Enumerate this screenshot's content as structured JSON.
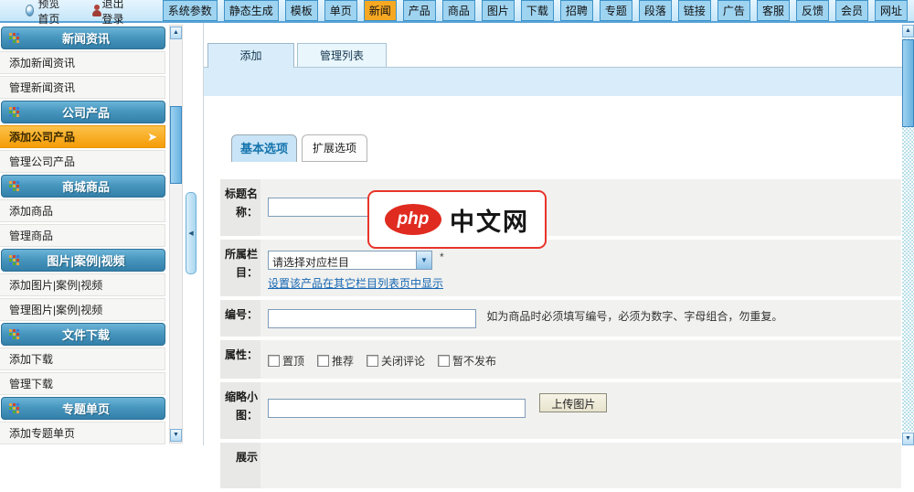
{
  "topbar": {
    "preview_label": "预览首页",
    "logout_label": "退出登录",
    "menu": [
      "系统参数",
      "静态生成",
      "模板",
      "单页",
      "新闻",
      "产品",
      "商品",
      "图片",
      "下载",
      "招聘",
      "专题",
      "段落",
      "链接",
      "广告",
      "客服",
      "反馈",
      "会员",
      "网址"
    ],
    "active_menu": "新闻"
  },
  "sidebar": {
    "sections": [
      {
        "title": "新闻资讯",
        "items": [
          {
            "label": "添加新闻资讯"
          },
          {
            "label": "管理新闻资讯"
          }
        ]
      },
      {
        "title": "公司产品",
        "items": [
          {
            "label": "添加公司产品",
            "active": true
          },
          {
            "label": "管理公司产品"
          }
        ]
      },
      {
        "title": "商城商品",
        "items": [
          {
            "label": "添加商品"
          },
          {
            "label": "管理商品"
          }
        ]
      },
      {
        "title": "图片|案例|视频",
        "items": [
          {
            "label": "添加图片|案例|视频"
          },
          {
            "label": "管理图片|案例|视频"
          }
        ]
      },
      {
        "title": "文件下载",
        "items": [
          {
            "label": "添加下载"
          },
          {
            "label": "管理下载"
          }
        ]
      },
      {
        "title": "专题单页",
        "items": [
          {
            "label": "添加专题单页"
          }
        ]
      }
    ]
  },
  "main": {
    "tabs": [
      {
        "label": "添加",
        "active": true
      },
      {
        "label": "管理列表",
        "active": false
      }
    ],
    "subtabs": [
      {
        "label": "基本选项",
        "active": true
      },
      {
        "label": "扩展选项",
        "active": false
      }
    ],
    "form": {
      "title": {
        "label": "标题名称：",
        "value": ""
      },
      "category": {
        "label": "所属栏目：",
        "select_value": "请选择对应栏目",
        "required_mark": "*",
        "link": "设置该产品在其它栏目列表页中显示"
      },
      "code": {
        "label": "编号：",
        "value": "",
        "hint": "如为商品时必须填写编号，必须为数字、字母组合，勿重复。"
      },
      "attrs": {
        "label": "属性：",
        "options": [
          "置顶",
          "推荐",
          "关闭评论",
          "暂不发布"
        ]
      },
      "thumb": {
        "label": "缩略小图：",
        "value": "",
        "button": "上传图片"
      },
      "display": {
        "label": "展示"
      }
    }
  },
  "watermark": {
    "badge": "php",
    "text": "中文网"
  },
  "colors": {
    "accent_orange": "#f7a823",
    "sidebar_header_blue": "#4897bf",
    "band_blue": "#d8ecfa",
    "link_blue": "#1668b4",
    "watermark_red": "#e02b20"
  }
}
